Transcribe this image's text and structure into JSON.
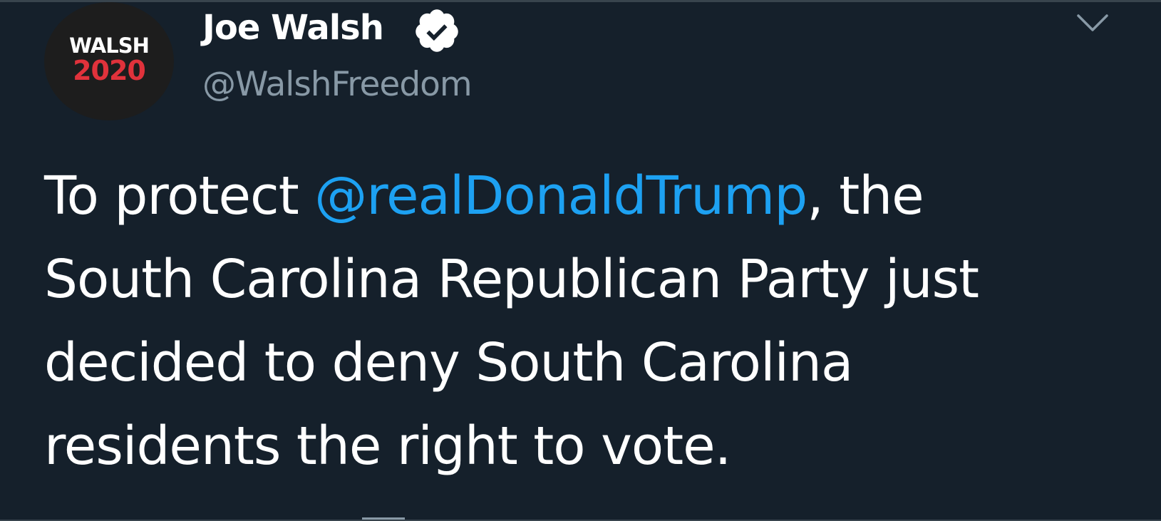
{
  "author": {
    "avatar": {
      "line1": "WALSH",
      "line2": "2020",
      "line2_color": "#e0323b",
      "background": "#1d1d1d"
    },
    "display_name": "Joe Walsh",
    "verified": true,
    "handle": "@WalshFreedom"
  },
  "tweet": {
    "text_before": "To protect ",
    "mention": "@realDonaldTrump",
    "text_after": ", the\nSouth Carolina Republican Party just\ndecided to deny South Carolina\nresidents the right to vote."
  },
  "icons": {
    "verified": "verified-badge-icon",
    "menu": "chevron-down-icon"
  },
  "colors": {
    "background": "#15202b",
    "text": "#ffffff",
    "secondary_text": "#8899a6",
    "link": "#1da1f2"
  }
}
